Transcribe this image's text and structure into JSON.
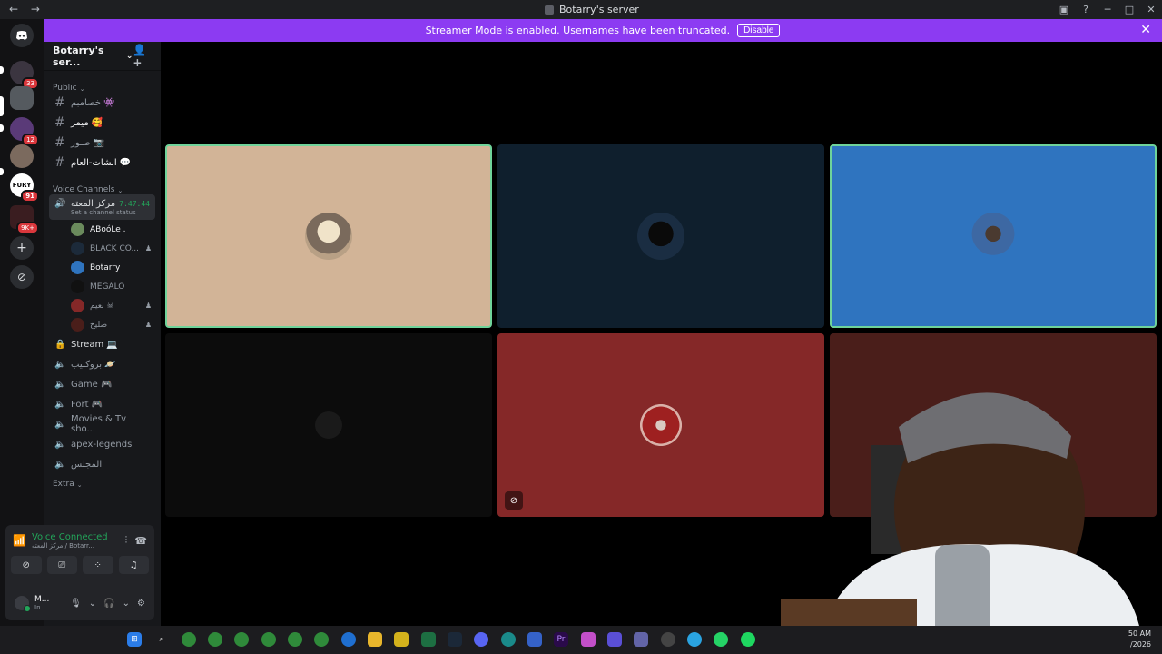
{
  "window": {
    "title": "Botarry's server",
    "back": "←",
    "forward": "→"
  },
  "banner": {
    "message": "Streamer Mode is enabled. Usernames have been truncated.",
    "disable_label": "Disable",
    "close": "✕"
  },
  "guilds": [
    {
      "name": "home",
      "label": "◉"
    },
    {
      "name": "server-1",
      "badge": "33"
    },
    {
      "name": "server-2",
      "badge": ""
    },
    {
      "name": "server-3",
      "badge": "12"
    },
    {
      "name": "server-4",
      "badge": ""
    },
    {
      "name": "fury",
      "label": "FURY",
      "badge": "91"
    },
    {
      "name": "server-6",
      "badge": "9K+"
    }
  ],
  "server": {
    "name": "Botarry's ser...",
    "categories": {
      "public": "Public",
      "voice": "Voice Channels",
      "extra": "Extra"
    },
    "text_channels": [
      "خصامبم 👾",
      "ميمز 🥰",
      "صـور 📷",
      "الشات-العام 💬"
    ],
    "active_voice": {
      "name": "مركز المعته",
      "timer": "7:47:44",
      "status": "Set a channel status"
    },
    "voice_users": [
      {
        "name": "ABoóLe .",
        "me": false,
        "ps": ""
      },
      {
        "name": "BLACK CO...",
        "me": false,
        "ps": "♟"
      },
      {
        "name": "Botarry",
        "me": true,
        "ps": ""
      },
      {
        "name": "MEGALO",
        "me": false,
        "ps": ""
      },
      {
        "name": "نعيم ☠",
        "me": false,
        "ps": "♟"
      },
      {
        "name": "صليح",
        "me": false,
        "ps": "♟"
      }
    ],
    "voice_channels": [
      "Stream 💻",
      "بروكليب 🪐",
      "Game 🎮",
      "Fort 🎮",
      "Movies & Tv sho...",
      "apex-legends",
      "المجلس"
    ]
  },
  "voice_panel": {
    "title": "Voice Connected",
    "subtitle": "مركز المعته / Botarr...",
    "user_name": "M...",
    "user_status": "In"
  },
  "tiles": [
    {
      "name": "tile-aboole",
      "bg": "#d2b497",
      "speaking": true,
      "muted": false
    },
    {
      "name": "tile-black",
      "bg": "#0f1f2d",
      "speaking": false,
      "muted": false
    },
    {
      "name": "tile-botarry",
      "bg": "#2f74bf",
      "speaking": true,
      "muted": false
    },
    {
      "name": "tile-megalo",
      "bg": "#0c0c0c",
      "speaking": false,
      "muted": false
    },
    {
      "name": "tile-naeem",
      "bg": "#852828",
      "speaking": false,
      "muted": true
    },
    {
      "name": "tile-salih",
      "bg": "#4a1e1a",
      "speaking": false,
      "muted": false
    }
  ],
  "taskbar": {
    "clock_time": "50 AM",
    "clock_date": "/2026",
    "apps": [
      "windows",
      "search",
      "chrome",
      "chrome",
      "chrome",
      "chrome",
      "chrome",
      "chrome",
      "edge",
      "files",
      "notes",
      "excel",
      "steam",
      "discord",
      "edge",
      "photos",
      "premiere",
      "photos",
      "apps",
      "teams",
      "chrome",
      "telegram",
      "whatsapp",
      "spotify"
    ]
  }
}
